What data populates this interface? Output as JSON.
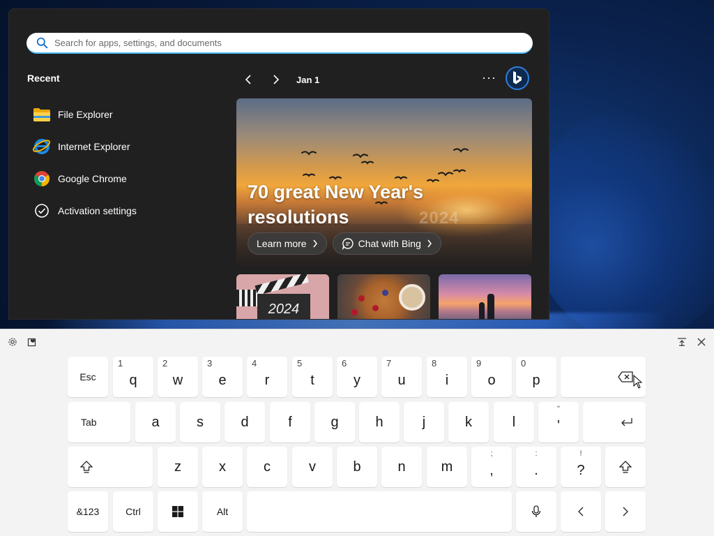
{
  "start": {
    "search_placeholder": "Search for apps, settings, and documents",
    "recent_title": "Recent",
    "recent_items": [
      {
        "label": "File Explorer",
        "icon": "folder-icon"
      },
      {
        "label": "Internet Explorer",
        "icon": "internet-explorer-icon"
      },
      {
        "label": "Google Chrome",
        "icon": "chrome-icon"
      },
      {
        "label": "Activation settings",
        "icon": "check-circle-icon"
      }
    ],
    "date": "Jan 1",
    "more_label": "···",
    "hero": {
      "title": "70 great New Year's resolutions",
      "watermark": "2024",
      "learn_more": "Learn more",
      "chat_with_bing": "Chat with Bing"
    },
    "thumbs": [
      {
        "icon": "clapperboard-image",
        "text": "2024"
      },
      {
        "icon": "waffles-image"
      },
      {
        "icon": "sunset-couple-image"
      }
    ],
    "accent_color": "#4cc2ff"
  },
  "keyboard": {
    "row1": [
      {
        "label": "Esc"
      },
      {
        "label": "q",
        "num": "1"
      },
      {
        "label": "w",
        "num": "2"
      },
      {
        "label": "e",
        "num": "3"
      },
      {
        "label": "r",
        "num": "4"
      },
      {
        "label": "t",
        "num": "5"
      },
      {
        "label": "y",
        "num": "6"
      },
      {
        "label": "u",
        "num": "7"
      },
      {
        "label": "i",
        "num": "8"
      },
      {
        "label": "o",
        "num": "9"
      },
      {
        "label": "p",
        "num": "0"
      }
    ],
    "row2": [
      {
        "label": "Tab"
      },
      {
        "label": "a"
      },
      {
        "label": "s"
      },
      {
        "label": "d"
      },
      {
        "label": "f"
      },
      {
        "label": "g"
      },
      {
        "label": "h"
      },
      {
        "label": "j"
      },
      {
        "label": "k"
      },
      {
        "label": "l"
      },
      {
        "label": "'",
        "alt": "\""
      }
    ],
    "row3": [
      {
        "label": "z"
      },
      {
        "label": "x"
      },
      {
        "label": "c"
      },
      {
        "label": "v"
      },
      {
        "label": "b"
      },
      {
        "label": "n"
      },
      {
        "label": "m"
      },
      {
        "label": ",",
        "alt": ";"
      },
      {
        "label": ".",
        "alt": ":"
      },
      {
        "label": "?",
        "alt": "!"
      }
    ],
    "row4": {
      "symbols": "&123",
      "ctrl": "Ctrl",
      "alt": "Alt"
    }
  }
}
